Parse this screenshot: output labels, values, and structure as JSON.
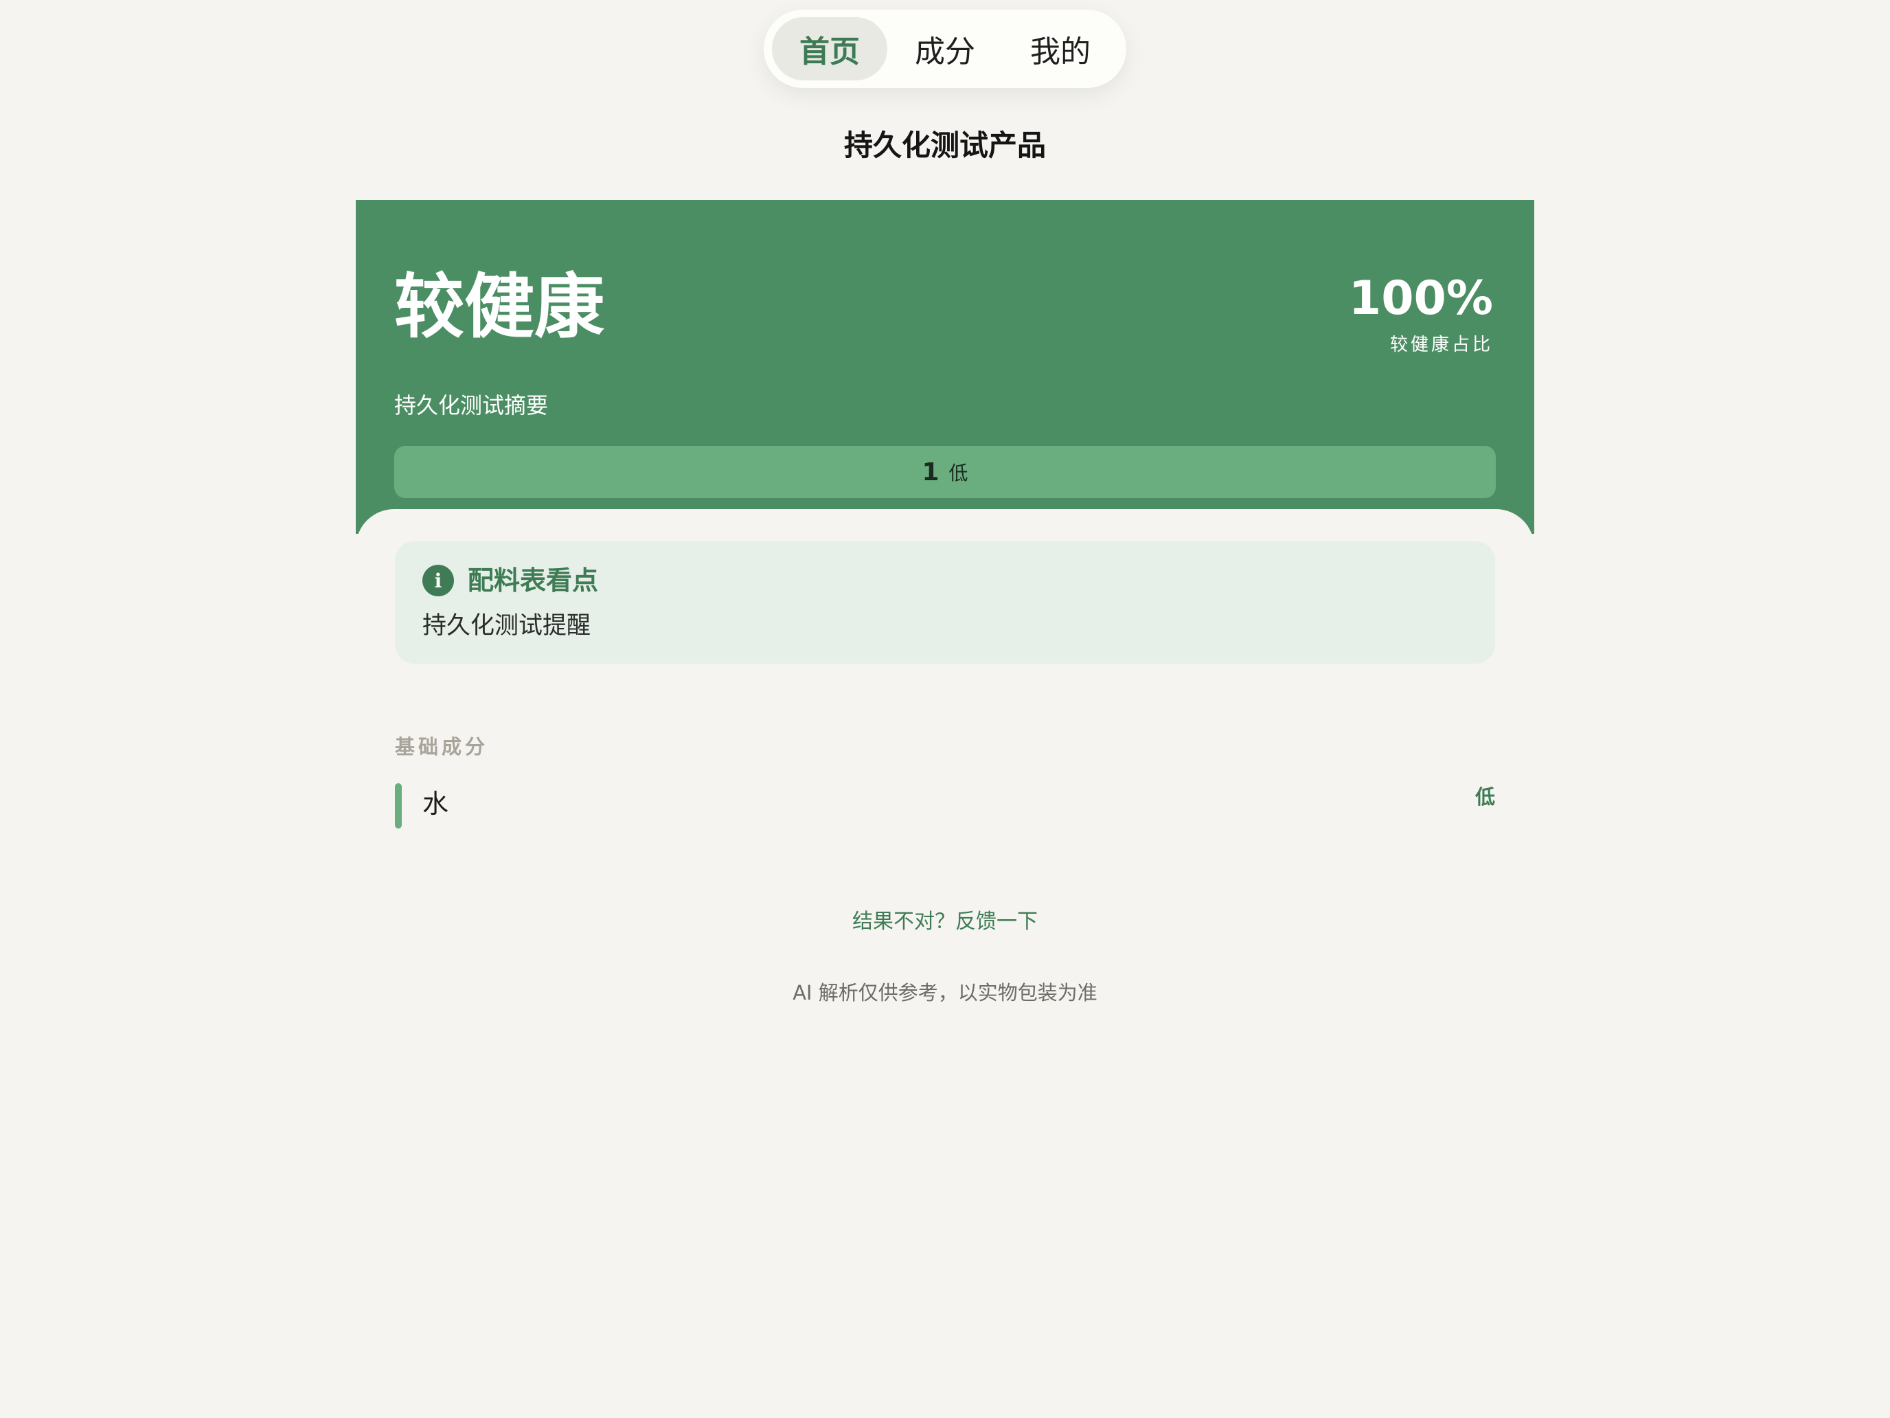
{
  "nav": {
    "tabs": [
      {
        "label": "首页",
        "active": true
      },
      {
        "label": "成分",
        "active": false
      },
      {
        "label": "我的",
        "active": false
      }
    ]
  },
  "page": {
    "title": "持久化测试产品"
  },
  "hero": {
    "rating": "较健康",
    "percent": "100%",
    "percent_label": "较健康占比",
    "summary": "持久化测试摘要",
    "bar_count": "1",
    "bar_level": "低",
    "color": "#4c8e64",
    "bar_color": "#6aae7f"
  },
  "info": {
    "icon": "info-icon",
    "icon_glyph": "i",
    "title": "配料表看点",
    "text": "持久化测试提醒"
  },
  "section": {
    "label": "基础成分"
  },
  "ingredients": [
    {
      "name": "水",
      "level": "低"
    }
  ],
  "footer": {
    "feedback": "结果不对？反馈一下",
    "disclaimer": "AI 解析仅供参考，以实物包装为准"
  }
}
